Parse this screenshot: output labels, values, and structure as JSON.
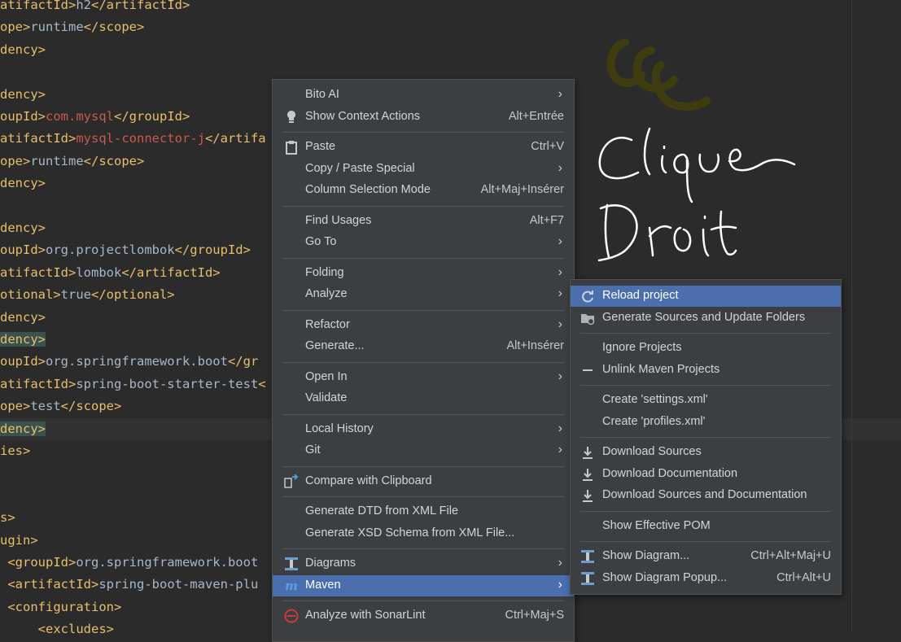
{
  "editor": {
    "lines": [
      {
        "parts": [
          {
            "t": "atifactId>",
            "c": "tag"
          },
          {
            "t": "h2",
            "c": "val"
          },
          {
            "t": "</artifactId>",
            "c": "tag"
          }
        ]
      },
      {
        "parts": [
          {
            "t": "ope>",
            "c": "tag"
          },
          {
            "t": "runtime",
            "c": "val"
          },
          {
            "t": "</scope>",
            "c": "tag"
          }
        ]
      },
      {
        "parts": [
          {
            "t": "dency>",
            "c": "tag"
          }
        ]
      },
      {
        "parts": []
      },
      {
        "parts": [
          {
            "t": "dency>",
            "c": "tag"
          }
        ]
      },
      {
        "parts": [
          {
            "t": "oupId>",
            "c": "tag"
          },
          {
            "t": "com.mysql",
            "c": "red"
          },
          {
            "t": "</groupId>",
            "c": "tag"
          }
        ]
      },
      {
        "parts": [
          {
            "t": "atifactId>",
            "c": "tag"
          },
          {
            "t": "mysql-connector-j",
            "c": "red"
          },
          {
            "t": "</artifa",
            "c": "tag"
          }
        ]
      },
      {
        "parts": [
          {
            "t": "ope>",
            "c": "tag"
          },
          {
            "t": "runtime",
            "c": "val"
          },
          {
            "t": "</scope>",
            "c": "tag"
          }
        ]
      },
      {
        "parts": [
          {
            "t": "dency>",
            "c": "tag"
          }
        ]
      },
      {
        "parts": []
      },
      {
        "parts": [
          {
            "t": "dency>",
            "c": "tag"
          }
        ]
      },
      {
        "parts": [
          {
            "t": "oupId>",
            "c": "tag"
          },
          {
            "t": "org.projectlombok",
            "c": "val"
          },
          {
            "t": "</groupId>",
            "c": "tag"
          }
        ]
      },
      {
        "parts": [
          {
            "t": "atifactId>",
            "c": "tag"
          },
          {
            "t": "lombok",
            "c": "val"
          },
          {
            "t": "</artifactId>",
            "c": "tag"
          }
        ]
      },
      {
        "parts": [
          {
            "t": "otional>",
            "c": "tag"
          },
          {
            "t": "true",
            "c": "val"
          },
          {
            "t": "</optional>",
            "c": "tag"
          }
        ]
      },
      {
        "parts": [
          {
            "t": "dency>",
            "c": "tag"
          }
        ]
      },
      {
        "parts": [
          {
            "t": "dency>",
            "c": "tag hl"
          }
        ]
      },
      {
        "parts": [
          {
            "t": "oupId>",
            "c": "tag"
          },
          {
            "t": "org.springframework.boot",
            "c": "val"
          },
          {
            "t": "</gr",
            "c": "tag"
          }
        ]
      },
      {
        "parts": [
          {
            "t": "atifactId>",
            "c": "tag"
          },
          {
            "t": "spring-boot-starter-test",
            "c": "val"
          },
          {
            "t": "<",
            "c": "tag"
          }
        ]
      },
      {
        "parts": [
          {
            "t": "ope>",
            "c": "tag"
          },
          {
            "t": "test",
            "c": "val"
          },
          {
            "t": "</scope>",
            "c": "tag"
          }
        ]
      },
      {
        "parts": [
          {
            "t": "dency>",
            "c": "tag hl"
          }
        ]
      },
      {
        "parts": [
          {
            "t": "ies>",
            "c": "tag"
          }
        ]
      },
      {
        "parts": []
      },
      {
        "parts": []
      },
      {
        "parts": [
          {
            "t": "s>",
            "c": "tag"
          }
        ]
      },
      {
        "parts": [
          {
            "t": "ugin>",
            "c": "tag"
          }
        ]
      },
      {
        "parts": [
          {
            "t": " <groupId>",
            "c": "tag"
          },
          {
            "t": "org.springframework.boot",
            "c": "val"
          }
        ]
      },
      {
        "parts": [
          {
            "t": " <artifactId>",
            "c": "tag"
          },
          {
            "t": "spring-boot-maven-plu",
            "c": "val"
          }
        ]
      },
      {
        "parts": [
          {
            "t": " <configuration>",
            "c": "tag"
          }
        ]
      },
      {
        "parts": [
          {
            "t": "     <excludes>",
            "c": "tag"
          }
        ]
      }
    ]
  },
  "context_menu": {
    "items": [
      {
        "label": "Bito AI",
        "shortcut": "",
        "submenu": true,
        "icon": ""
      },
      {
        "label": "Show Context Actions",
        "shortcut": "Alt+Entrée",
        "submenu": false,
        "icon": "lightbulb-icon"
      },
      {
        "sep": true
      },
      {
        "label": "Paste",
        "shortcut": "Ctrl+V",
        "submenu": false,
        "icon": "clipboard-icon"
      },
      {
        "label": "Copy / Paste Special",
        "shortcut": "",
        "submenu": true,
        "icon": ""
      },
      {
        "label": "Column Selection Mode",
        "shortcut": "Alt+Maj+Insérer",
        "submenu": false,
        "icon": ""
      },
      {
        "sep": true
      },
      {
        "label": "Find Usages",
        "shortcut": "Alt+F7",
        "submenu": false,
        "icon": ""
      },
      {
        "label": "Go To",
        "shortcut": "",
        "submenu": true,
        "icon": ""
      },
      {
        "sep": true
      },
      {
        "label": "Folding",
        "shortcut": "",
        "submenu": true,
        "icon": ""
      },
      {
        "label": "Analyze",
        "shortcut": "",
        "submenu": true,
        "icon": ""
      },
      {
        "sep": true
      },
      {
        "label": "Refactor",
        "shortcut": "",
        "submenu": true,
        "icon": ""
      },
      {
        "label": "Generate...",
        "shortcut": "Alt+Insérer",
        "submenu": false,
        "icon": ""
      },
      {
        "sep": true
      },
      {
        "label": "Open In",
        "shortcut": "",
        "submenu": true,
        "icon": ""
      },
      {
        "label": "Validate",
        "shortcut": "",
        "submenu": false,
        "icon": ""
      },
      {
        "sep": true
      },
      {
        "label": "Local History",
        "shortcut": "",
        "submenu": true,
        "icon": ""
      },
      {
        "label": "Git",
        "shortcut": "",
        "submenu": true,
        "icon": ""
      },
      {
        "sep": true
      },
      {
        "label": "Compare with Clipboard",
        "shortcut": "",
        "submenu": false,
        "icon": "compare-icon"
      },
      {
        "sep": true
      },
      {
        "label": "Generate DTD from XML File",
        "shortcut": "",
        "submenu": false,
        "icon": ""
      },
      {
        "label": "Generate XSD Schema from XML File...",
        "shortcut": "",
        "submenu": false,
        "icon": ""
      },
      {
        "sep": true
      },
      {
        "label": "Diagrams",
        "shortcut": "",
        "submenu": true,
        "icon": "diagram-icon"
      },
      {
        "label": "Maven",
        "shortcut": "",
        "submenu": true,
        "icon": "maven-icon",
        "selected": true
      },
      {
        "sep": true
      },
      {
        "label": "Analyze with SonarLint",
        "shortcut": "Ctrl+Maj+S",
        "submenu": false,
        "icon": "sonarlint-icon"
      }
    ]
  },
  "maven_submenu": {
    "items": [
      {
        "label": "Reload project",
        "shortcut": "",
        "icon": "reload-icon",
        "selected": true
      },
      {
        "label": "Generate Sources and Update Folders",
        "shortcut": "",
        "icon": "folder-sync-icon"
      },
      {
        "sep": true
      },
      {
        "label": "Ignore Projects",
        "shortcut": "",
        "icon": ""
      },
      {
        "label": "Unlink Maven Projects",
        "shortcut": "",
        "icon": "minus-icon"
      },
      {
        "sep": true
      },
      {
        "label": "Create 'settings.xml'",
        "shortcut": "",
        "icon": ""
      },
      {
        "label": "Create 'profiles.xml'",
        "shortcut": "",
        "icon": ""
      },
      {
        "sep": true
      },
      {
        "label": "Download Sources",
        "shortcut": "",
        "icon": "download-icon"
      },
      {
        "label": "Download Documentation",
        "shortcut": "",
        "icon": "download-icon"
      },
      {
        "label": "Download Sources and Documentation",
        "shortcut": "",
        "icon": "download-icon"
      },
      {
        "sep": true
      },
      {
        "label": "Show Effective POM",
        "shortcut": "",
        "icon": ""
      },
      {
        "sep": true
      },
      {
        "label": "Show Diagram...",
        "shortcut": "Ctrl+Alt+Maj+U",
        "icon": "diagram-icon"
      },
      {
        "label": "Show Diagram Popup...",
        "shortcut": "Ctrl+Alt+U",
        "icon": "diagram-icon"
      }
    ]
  },
  "annotation": {
    "handwritten_text": "Clique Droit"
  },
  "colors": {
    "editor_bg": "#2b2b2b",
    "menu_bg": "#3c3f41",
    "selection": "#4b6eaf",
    "xml_tag": "#e8bf6a",
    "xml_string": "#cc5a4f",
    "annotation_stroke": "#ffffff",
    "logo_stroke": "#3d3d10"
  }
}
